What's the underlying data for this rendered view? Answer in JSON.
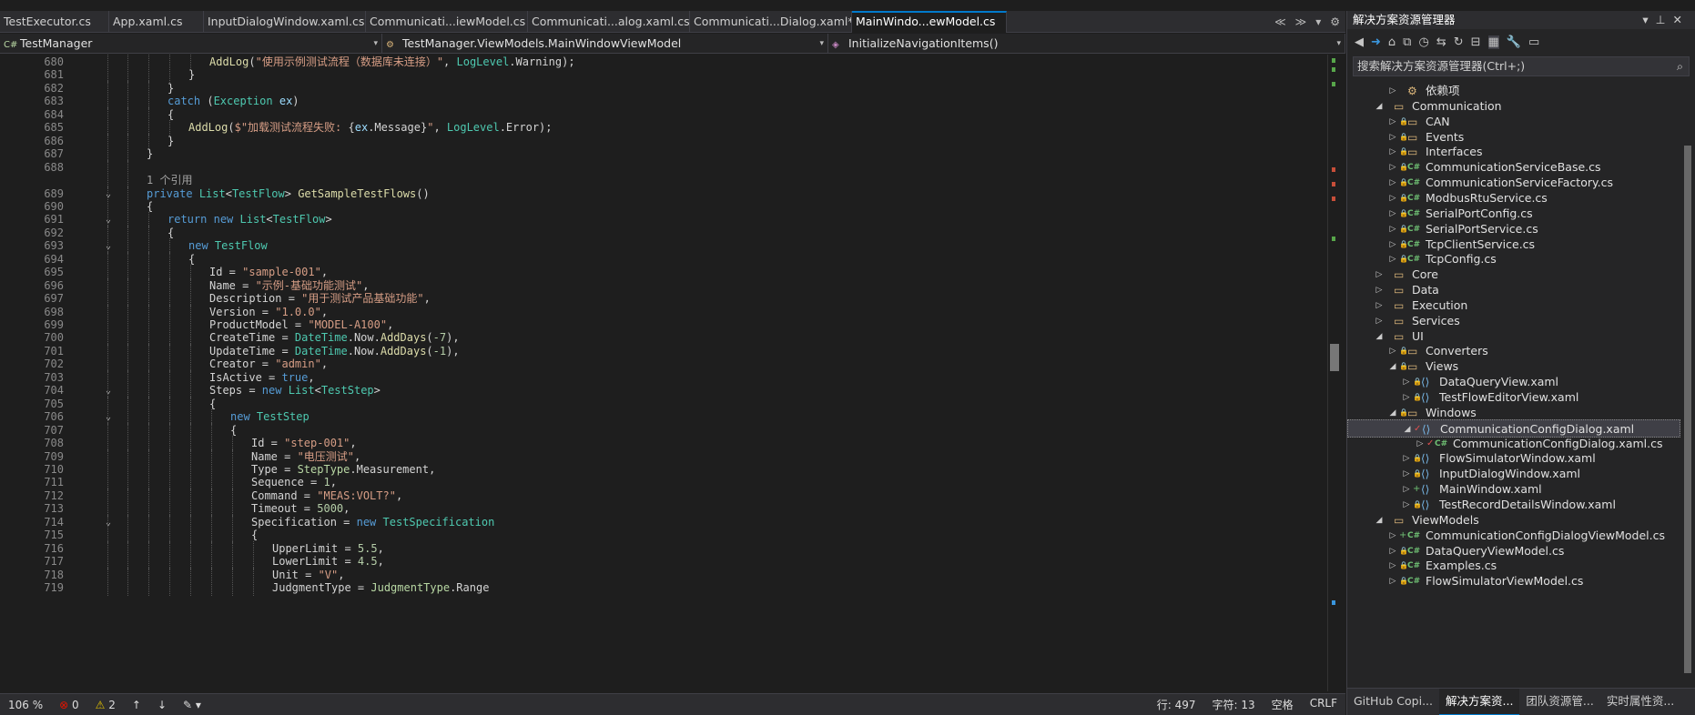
{
  "tabs": [
    "TestExecutor.cs",
    "App.xaml.cs",
    "InputDialogWindow.xaml.cs",
    "Communicati...iewModel.cs",
    "Communicati...alog.xaml.cs",
    "Communicati...Dialog.xaml*",
    "MainWindo...ewModel.cs"
  ],
  "active_tab_close": "✕",
  "navbar": {
    "project": "TestManager",
    "type": "TestManager.ViewModels.MainWindowViewModel",
    "member": "InitializeNavigationItems()"
  },
  "code_lines": [
    {
      "n": "680",
      "html": "<span class='fn'>AddLog</span><span class='pl'>(</span><span class='st'>\"使用示例测试流程（数据库未连接）\"</span><span class='pl'>, </span><span class='ty'>LogLevel</span><span class='pl'>.Warning);</span>",
      "indent": 230
    },
    {
      "n": "681",
      "html": "<span class='pl'>}</span>",
      "indent": 207
    },
    {
      "n": "682",
      "html": "<span class='pl'>}</span>",
      "indent": 184
    },
    {
      "n": "683",
      "html": "<span class='kw'>catch</span><span class='pl'> (</span><span class='ty'>Exception</span><span class='pl'> </span><span class='vr'>ex</span><span class='pl'>)</span>",
      "indent": 184
    },
    {
      "n": "684",
      "html": "<span class='pl'>{</span>",
      "indent": 184
    },
    {
      "n": "685",
      "html": "<span class='fn'>AddLog</span><span class='pl'>(</span><span class='st'>$\"加载测试流程失败: </span><span class='pl'>{</span><span class='vr'>ex</span><span class='pl'>.Message}</span><span class='st'>\"</span><span class='pl'>, </span><span class='ty'>LogLevel</span><span class='pl'>.Error);</span>",
      "indent": 207
    },
    {
      "n": "686",
      "html": "<span class='pl'>}</span>",
      "indent": 184
    },
    {
      "n": "687",
      "html": "<span class='pl'>}</span>",
      "indent": 161
    },
    {
      "n": "688",
      "html": "",
      "indent": 161
    },
    {
      "n": "",
      "html": "<span class='cm'>1 个引用</span>",
      "indent": 161
    },
    {
      "n": "689",
      "html": "<span class='kw'>private</span><span class='pl'> </span><span class='ty'>List</span><span class='pl'>&lt;</span><span class='ty'>TestFlow</span><span class='pl'>&gt; </span><span class='fn'>GetSampleTestFlows</span><span class='pl'>()</span>",
      "indent": 161,
      "fold": true
    },
    {
      "n": "690",
      "html": "<span class='pl'>{</span>",
      "indent": 161
    },
    {
      "n": "691",
      "html": "<span class='kw'>return</span><span class='pl'> </span><span class='kw'>new</span><span class='pl'> </span><span class='ty'>List</span><span class='pl'>&lt;</span><span class='ty'>TestFlow</span><span class='pl'>&gt;</span>",
      "indent": 184,
      "fold": true
    },
    {
      "n": "692",
      "html": "<span class='pl'>{</span>",
      "indent": 184
    },
    {
      "n": "693",
      "html": "<span class='kw'>new</span><span class='pl'> </span><span class='ty'>TestFlow</span>",
      "indent": 207,
      "fold": true
    },
    {
      "n": "694",
      "html": "<span class='pl'>{</span>",
      "indent": 207
    },
    {
      "n": "695",
      "html": "<span class='pl'>Id = </span><span class='st'>\"sample-001\"</span><span class='pl'>,</span>",
      "indent": 230
    },
    {
      "n": "696",
      "html": "<span class='pl'>Name = </span><span class='st'>\"示例-基础功能测试\"</span><span class='pl'>,</span>",
      "indent": 230
    },
    {
      "n": "697",
      "html": "<span class='pl'>Description = </span><span class='st'>\"用于测试产品基础功能\"</span><span class='pl'>,</span>",
      "indent": 230
    },
    {
      "n": "698",
      "html": "<span class='pl'>Version = </span><span class='st'>\"1.0.0\"</span><span class='pl'>,</span>",
      "indent": 230
    },
    {
      "n": "699",
      "html": "<span class='pl'>ProductModel = </span><span class='st'>\"MODEL-A100\"</span><span class='pl'>,</span>",
      "indent": 230
    },
    {
      "n": "700",
      "html": "<span class='pl'>CreateTime = </span><span class='ty'>DateTime</span><span class='pl'>.Now.</span><span class='fn'>AddDays</span><span class='pl'>(</span><span class='nm'>-7</span><span class='pl'>),</span>",
      "indent": 230
    },
    {
      "n": "701",
      "html": "<span class='pl'>UpdateTime = </span><span class='ty'>DateTime</span><span class='pl'>.Now.</span><span class='fn'>AddDays</span><span class='pl'>(</span><span class='nm'>-1</span><span class='pl'>),</span>",
      "indent": 230
    },
    {
      "n": "702",
      "html": "<span class='pl'>Creator = </span><span class='st'>\"admin\"</span><span class='pl'>,</span>",
      "indent": 230
    },
    {
      "n": "703",
      "html": "<span class='pl'>IsActive = </span><span class='kw'>true</span><span class='pl'>,</span>",
      "indent": 230
    },
    {
      "n": "704",
      "html": "<span class='pl'>Steps = </span><span class='kw'>new</span><span class='pl'> </span><span class='ty'>List</span><span class='pl'>&lt;</span><span class='ty'>TestStep</span><span class='pl'>&gt;</span>",
      "indent": 230,
      "fold": true
    },
    {
      "n": "705",
      "html": "<span class='pl'>{</span>",
      "indent": 230
    },
    {
      "n": "706",
      "html": "<span class='kw'>new</span><span class='pl'> </span><span class='ty'>TestStep</span>",
      "indent": 253,
      "fold": true
    },
    {
      "n": "707",
      "html": "<span class='pl'>{</span>",
      "indent": 253
    },
    {
      "n": "708",
      "html": "<span class='pl'>Id = </span><span class='st'>\"step-001\"</span><span class='pl'>,</span>",
      "indent": 276
    },
    {
      "n": "709",
      "html": "<span class='pl'>Name = </span><span class='st'>\"电压测试\"</span><span class='pl'>,</span>",
      "indent": 276
    },
    {
      "n": "710",
      "html": "<span class='pl'>Type = </span><span class='en'>StepType</span><span class='pl'>.Measurement,</span>",
      "indent": 276
    },
    {
      "n": "711",
      "html": "<span class='pl'>Sequence = </span><span class='nm'>1</span><span class='pl'>,</span>",
      "indent": 276
    },
    {
      "n": "712",
      "html": "<span class='pl'>Command = </span><span class='st'>\"MEAS:VOLT?\"</span><span class='pl'>,</span>",
      "indent": 276
    },
    {
      "n": "713",
      "html": "<span class='pl'>Timeout = </span><span class='nm'>5000</span><span class='pl'>,</span>",
      "indent": 276
    },
    {
      "n": "714",
      "html": "<span class='pl'>Specification = </span><span class='kw'>new</span><span class='pl'> </span><span class='ty'>TestSpecification</span>",
      "indent": 276,
      "fold": true
    },
    {
      "n": "715",
      "html": "<span class='pl'>{</span>",
      "indent": 276
    },
    {
      "n": "716",
      "html": "<span class='pl'>UpperLimit = </span><span class='nm'>5.5</span><span class='pl'>,</span>",
      "indent": 299
    },
    {
      "n": "717",
      "html": "<span class='pl'>LowerLimit = </span><span class='nm'>4.5</span><span class='pl'>,</span>",
      "indent": 299
    },
    {
      "n": "718",
      "html": "<span class='pl'>Unit = </span><span class='st'>\"V\"</span><span class='pl'>,</span>",
      "indent": 299
    },
    {
      "n": "719",
      "html": "<span class='pl'>JudgmentType = </span><span class='en'>JudgmentType</span><span class='pl'>.Range</span>",
      "indent": 299
    }
  ],
  "status": {
    "zoom": "106 %",
    "errors": "0",
    "warnings": "2",
    "line": "行: 497",
    "char": "字符: 13",
    "ws": "空格",
    "eol": "CRLF"
  },
  "panel": {
    "title": "解决方案资源管理器",
    "search_placeholder": "搜索解决方案资源管理器(Ctrl+;)"
  },
  "tree": [
    {
      "label": "依赖项",
      "depth": 2,
      "kind": "deps",
      "tw": "▷"
    },
    {
      "label": "Communication",
      "depth": 1,
      "kind": "folder",
      "tw": "◢"
    },
    {
      "label": "CAN",
      "depth": 2,
      "kind": "folder",
      "tw": "▷",
      "lock": true
    },
    {
      "label": "Events",
      "depth": 2,
      "kind": "folder",
      "tw": "▷",
      "lock": true
    },
    {
      "label": "Interfaces",
      "depth": 2,
      "kind": "folder",
      "tw": "▷",
      "lock": true
    },
    {
      "label": "CommunicationServiceBase.cs",
      "depth": 2,
      "kind": "cs",
      "tw": "▷",
      "lock": true
    },
    {
      "label": "CommunicationServiceFactory.cs",
      "depth": 2,
      "kind": "cs",
      "tw": "▷",
      "lock": true
    },
    {
      "label": "ModbusRtuService.cs",
      "depth": 2,
      "kind": "cs",
      "tw": "▷",
      "lock": true
    },
    {
      "label": "SerialPortConfig.cs",
      "depth": 2,
      "kind": "cs",
      "tw": "▷",
      "lock": true
    },
    {
      "label": "SerialPortService.cs",
      "depth": 2,
      "kind": "cs",
      "tw": "▷",
      "lock": true
    },
    {
      "label": "TcpClientService.cs",
      "depth": 2,
      "kind": "cs",
      "tw": "▷",
      "lock": true
    },
    {
      "label": "TcpConfig.cs",
      "depth": 2,
      "kind": "cs",
      "tw": "▷",
      "lock": true
    },
    {
      "label": "Core",
      "depth": 1,
      "kind": "folder",
      "tw": "▷"
    },
    {
      "label": "Data",
      "depth": 1,
      "kind": "folder",
      "tw": "▷"
    },
    {
      "label": "Execution",
      "depth": 1,
      "kind": "folder",
      "tw": "▷"
    },
    {
      "label": "Services",
      "depth": 1,
      "kind": "folder",
      "tw": "▷"
    },
    {
      "label": "UI",
      "depth": 1,
      "kind": "folder",
      "tw": "◢"
    },
    {
      "label": "Converters",
      "depth": 2,
      "kind": "folder",
      "tw": "▷",
      "lock": true
    },
    {
      "label": "Views",
      "depth": 2,
      "kind": "folder",
      "tw": "◢",
      "lock": true
    },
    {
      "label": "DataQueryView.xaml",
      "depth": 3,
      "kind": "xaml",
      "tw": "▷",
      "lock": true
    },
    {
      "label": "TestFlowEditorView.xaml",
      "depth": 3,
      "kind": "xaml",
      "tw": "▷",
      "lock": true
    },
    {
      "label": "Windows",
      "depth": 2,
      "kind": "folder",
      "tw": "◢",
      "lock": true
    },
    {
      "label": "CommunicationConfigDialog.xaml",
      "depth": 3,
      "kind": "xaml",
      "tw": "◢",
      "check": true,
      "sel": true
    },
    {
      "label": "CommunicationConfigDialog.xaml.cs",
      "depth": 4,
      "kind": "cs",
      "tw": "▷",
      "check": true
    },
    {
      "label": "FlowSimulatorWindow.xaml",
      "depth": 3,
      "kind": "xaml",
      "tw": "▷",
      "lock": true
    },
    {
      "label": "InputDialogWindow.xaml",
      "depth": 3,
      "kind": "xaml",
      "tw": "▷",
      "lock": true
    },
    {
      "label": "MainWindow.xaml",
      "depth": 3,
      "kind": "xaml",
      "tw": "▷",
      "plus": true
    },
    {
      "label": "TestRecordDetailsWindow.xaml",
      "depth": 3,
      "kind": "xaml",
      "tw": "▷",
      "lock": true
    },
    {
      "label": "ViewModels",
      "depth": 1,
      "kind": "folder",
      "tw": "◢"
    },
    {
      "label": "CommunicationConfigDialogViewModel.cs",
      "depth": 2,
      "kind": "cs",
      "tw": "▷",
      "plus": true
    },
    {
      "label": "DataQueryViewModel.cs",
      "depth": 2,
      "kind": "cs",
      "tw": "▷",
      "lock": true
    },
    {
      "label": "Examples.cs",
      "depth": 2,
      "kind": "cs",
      "tw": "▷",
      "lock": true
    },
    {
      "label": "FlowSimulatorViewModel.cs",
      "depth": 2,
      "kind": "cs",
      "tw": "▷",
      "lock": true
    }
  ],
  "panel_tabs": [
    "GitHub Copi...",
    "解决方案资...",
    "团队资源管...",
    "实时属性资..."
  ]
}
